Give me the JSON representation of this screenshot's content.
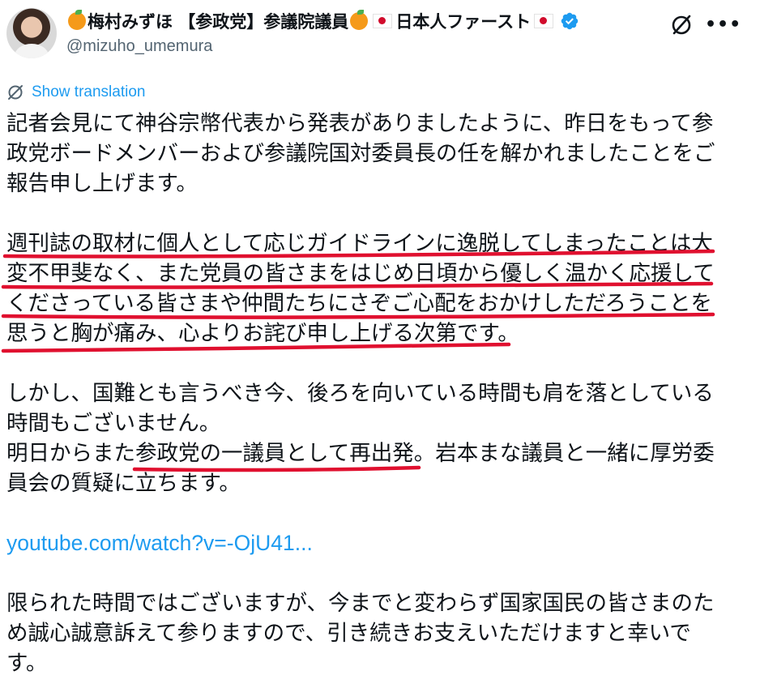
{
  "author": {
    "display_name_part1": "梅村みずほ 【参政党】参議院議員",
    "display_name_part2": "日本人ファースト",
    "handle": "@mizuho_umemura"
  },
  "icons": {
    "verified": "verified-badge-icon",
    "grok": "grok-icon",
    "more": "more-options-icon",
    "translate": "translate-icon",
    "more_glyph": "•••"
  },
  "colors": {
    "accent": "#1d9bf0",
    "underline": "#e0102f",
    "text": "#0f1419",
    "muted": "#536471"
  },
  "translate_label": "Show translation",
  "post": {
    "p1": [
      "記者会見にて神谷宗幣代表から発表がありましたように、昨日をもって参",
      "政党ボードメンバーおよび参議院国対委員長の任を解かれましたことをご",
      "報告申し上げます。"
    ],
    "p2": [
      "週刊誌の取材に個人として応じガイドラインに逸脱してしまったことは大",
      "変不甲斐なく、また党員の皆さまをはじめ日頃から優しく温かく応援して",
      "くださっている皆さまや仲間たちにさぞご心配をおかけしただろうことを",
      "思うと胸が痛み、心よりお詫び申し上げる次第です。"
    ],
    "p3": [
      "しかし、国難とも言うべき今、後ろを向いている時間も肩を落としている",
      "時間もございません。",
      "明日からまた参政党の一議員として再出発。岩本まな議員と一緒に厚労委",
      "員会の質疑に立ちます。"
    ],
    "link": "youtube.com/watch?v=-OjU41...",
    "p4": [
      "限られた時間ではございますが、今までと変わらず国家国民の皆さまのた",
      "め誠心誠意訴えて参りますので、引き続きお支えいただけますと幸いで",
      "す。"
    ]
  }
}
